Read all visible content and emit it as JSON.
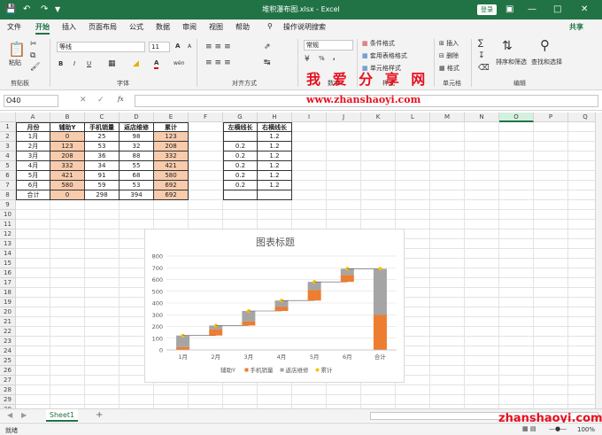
{
  "window": {
    "title": "堆积瀑布图.xlsx  -  Excel",
    "login": "登录"
  },
  "ribbon_tabs": [
    "文件",
    "开始",
    "插入",
    "页面布局",
    "公式",
    "数据",
    "审阅",
    "视图",
    "帮助"
  ],
  "search_hint": "操作说明搜索",
  "share": "共享",
  "clipboard": {
    "paste": "粘贴",
    "group": "剪贴板"
  },
  "font": {
    "name": "等线",
    "size": "11",
    "group": "字体",
    "bold": "B",
    "italic": "I",
    "underline": "U",
    "grow": "A",
    "shrink": "A",
    "color_a": "A",
    "wen": "wén"
  },
  "align": {
    "group": "对齐方式"
  },
  "number": {
    "format": "常规",
    "group": "数字",
    "percent": "%",
    "comma": ","
  },
  "styles": {
    "cond": "条件格式",
    "table": "套用表格格式",
    "cell": "单元格样式",
    "group": "样式"
  },
  "cells": {
    "insert": "插入",
    "delete": "删除",
    "format": "格式",
    "group": "单元格"
  },
  "editing": {
    "sort": "排序和筛选",
    "find": "查找和选择",
    "group": "编辑"
  },
  "namebox": "O40",
  "fx": "fx",
  "watermark": {
    "title": "我 爱 分 享 网",
    "url": "www.zhanshaoyi.com",
    "corner": "zhanshaoyi.com"
  },
  "columns": [
    "A",
    "B",
    "C",
    "D",
    "E",
    "F",
    "G",
    "H",
    "I",
    "J",
    "K",
    "L",
    "M",
    "N",
    "O",
    "P",
    "Q"
  ],
  "rows": [
    "1",
    "2",
    "3",
    "4",
    "5",
    "6",
    "7",
    "8",
    "9",
    "10",
    "11",
    "12",
    "13",
    "14",
    "15",
    "16",
    "17",
    "18",
    "19",
    "20",
    "21",
    "22",
    "23",
    "24",
    "25",
    "26",
    "27",
    "28",
    "29",
    "30"
  ],
  "table": {
    "headers": [
      "月份",
      "辅助Y",
      "手机销量",
      "返店维修",
      "累计"
    ],
    "rows": [
      [
        "1月",
        "0",
        "25",
        "98",
        "123"
      ],
      [
        "2月",
        "123",
        "53",
        "32",
        "208"
      ],
      [
        "3月",
        "208",
        "36",
        "88",
        "332"
      ],
      [
        "4月",
        "332",
        "34",
        "55",
        "421"
      ],
      [
        "5月",
        "421",
        "91",
        "68",
        "580"
      ],
      [
        "6月",
        "580",
        "59",
        "53",
        "692"
      ],
      [
        "合计",
        "0",
        "298",
        "394",
        "692"
      ]
    ]
  },
  "side": {
    "headers": [
      "左横线长",
      "右横线长"
    ],
    "rows": [
      [
        "",
        "1.2"
      ],
      [
        "0.2",
        "1.2"
      ],
      [
        "0.2",
        "1.2"
      ],
      [
        "0.2",
        "1.2"
      ],
      [
        "0.2",
        "1.2"
      ],
      [
        "0.2",
        "1.2"
      ],
      [
        "",
        ""
      ]
    ]
  },
  "chart_data": {
    "type": "bar",
    "title": "图表标题",
    "categories": [
      "1月",
      "2月",
      "3月",
      "4月",
      "5月",
      "6月",
      "合计"
    ],
    "series": [
      {
        "name": "辅助Y",
        "values": [
          0,
          123,
          208,
          332,
          421,
          580,
          0
        ]
      },
      {
        "name": "手机销量",
        "values": [
          25,
          53,
          36,
          34,
          91,
          59,
          298
        ]
      },
      {
        "name": "返店维修",
        "values": [
          98,
          32,
          88,
          55,
          68,
          53,
          394
        ]
      },
      {
        "name": "累计",
        "values": [
          123,
          208,
          332,
          421,
          580,
          692,
          692
        ]
      }
    ],
    "yticks": [
      "0",
      "100",
      "200",
      "300",
      "400",
      "500",
      "600",
      "700",
      "800"
    ],
    "ylim": [
      0,
      800
    ],
    "colors": {
      "手机销量": "#ed7d31",
      "返店维修": "#a5a5a5",
      "累计": "#ffc000"
    },
    "legend": "bottom",
    "grid": true
  },
  "sheet": {
    "name": "Sheet1",
    "add": "+"
  },
  "status": {
    "ready": "就绪",
    "zoom": "100%"
  }
}
